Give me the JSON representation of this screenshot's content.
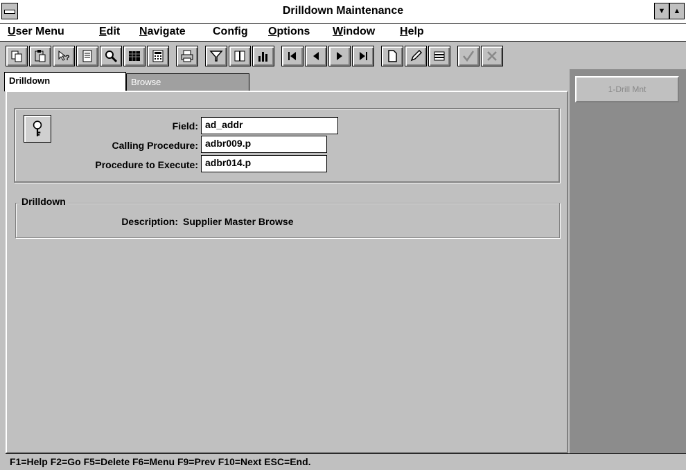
{
  "window": {
    "title": "Drilldown Maintenance"
  },
  "menu": [
    {
      "u": "U",
      "rest": "ser Menu"
    },
    {
      "u": "E",
      "rest": "dit"
    },
    {
      "u": "N",
      "rest": "avigate"
    },
    {
      "u": "",
      "rest": "Confi",
      "tail": "g"
    },
    {
      "u": "O",
      "rest": "ptions"
    },
    {
      "u": "W",
      "rest": "indow"
    },
    {
      "u": "H",
      "rest": "elp"
    }
  ],
  "tabs": {
    "active": "Drilldown",
    "inactive": "Browse"
  },
  "side_button": "1-Drill Mnt",
  "key": {
    "field_label": "Field:",
    "field_value": "ad_addr",
    "calling_label": "Calling Procedure:",
    "calling_value": "adbr009.p",
    "execute_label": "Procedure to Execute:",
    "execute_value": "adbr014.p"
  },
  "drilldown": {
    "group_title": "Drilldown",
    "description_label": "Description:",
    "description_value": "Supplier Master Browse"
  },
  "status": "F1=Help F2=Go F5=Delete F6=Menu F9=Prev F10=Next ESC=End.",
  "toolbar_icons": [
    "copy-icon",
    "paste-icon",
    "help-icon",
    "notes-icon",
    "search-icon",
    "grid-icon",
    "calculator-icon",
    "print-icon",
    "filter-icon",
    "frame-icon",
    "chart-icon",
    "first-record-icon",
    "prev-record-icon",
    "next-record-icon",
    "last-record-icon",
    "new-icon",
    "edit-icon",
    "delete-icon",
    "accept-icon",
    "cancel-icon"
  ]
}
